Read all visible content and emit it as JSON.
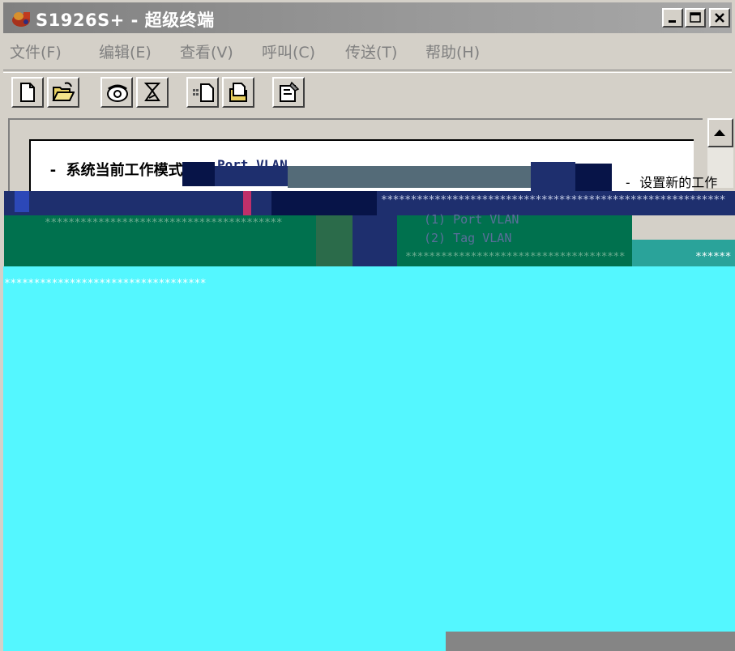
{
  "window": {
    "title": "S1926S+ - 超级终端",
    "controls": {
      "minimize_icon": "minimize-icon",
      "maximize_icon": "maximize-icon",
      "close_icon": "close-icon"
    }
  },
  "menu": [
    {
      "label": "文件(F)"
    },
    {
      "label": "编辑(E)"
    },
    {
      "label": "查看(V)"
    },
    {
      "label": "呼叫(C)"
    },
    {
      "label": "传送(T)"
    },
    {
      "label": "帮助(H)"
    }
  ],
  "toolbar": [
    {
      "icon": "new-icon"
    },
    {
      "icon": "open-icon"
    },
    {
      "icon": "call-icon"
    },
    {
      "icon": "disconnect-icon"
    },
    {
      "icon": "send-icon"
    },
    {
      "icon": "receive-icon"
    },
    {
      "icon": "properties-icon"
    }
  ],
  "terminal": {
    "line1": "- 系统当前工作模式",
    "line1_tail": "Port VLAN",
    "right_heading": "- 设置新的工作",
    "stars_top": "**********************************************************",
    "stars_left": "****************************************",
    "option1": "(1) Port VLAN",
    "option2": "(2) Tag VLAN",
    "stars_mid": "*************************************",
    "stars_right": "******",
    "stars_bottom": "**********************************"
  },
  "colors": {
    "cyan": "#54f7ff",
    "glitch_navy": "#1e2f6e",
    "glitch_green": "#00714e",
    "titlebar": "#9a9a9a"
  }
}
